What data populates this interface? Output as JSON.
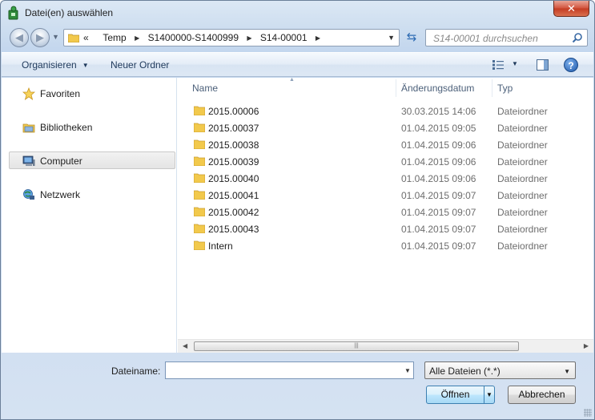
{
  "window": {
    "title": "Datei(en) auswählen",
    "close_label": "✕"
  },
  "address": {
    "crumbs_prefix": "«",
    "crumbs": [
      "Temp",
      "S1400000-S1400999",
      "S14-00001"
    ],
    "separator": "▶"
  },
  "search": {
    "placeholder": "S14-00001 durchsuchen"
  },
  "toolbar": {
    "organize_label": "Organisieren",
    "new_folder_label": "Neuer Ordner",
    "help_label": "?"
  },
  "nav": {
    "favorites": "Favoriten",
    "libraries": "Bibliotheken",
    "computer": "Computer",
    "network": "Netzwerk"
  },
  "columns": {
    "name": "Name",
    "date": "Änderungsdatum",
    "type": "Typ"
  },
  "files": [
    {
      "name": "2015.00006",
      "date": "30.03.2015 14:06",
      "type": "Dateiordner"
    },
    {
      "name": "2015.00037",
      "date": "01.04.2015 09:05",
      "type": "Dateiordner"
    },
    {
      "name": "2015.00038",
      "date": "01.04.2015 09:06",
      "type": "Dateiordner"
    },
    {
      "name": "2015.00039",
      "date": "01.04.2015 09:06",
      "type": "Dateiordner"
    },
    {
      "name": "2015.00040",
      "date": "01.04.2015 09:06",
      "type": "Dateiordner"
    },
    {
      "name": "2015.00041",
      "date": "01.04.2015 09:07",
      "type": "Dateiordner"
    },
    {
      "name": "2015.00042",
      "date": "01.04.2015 09:07",
      "type": "Dateiordner"
    },
    {
      "name": "2015.00043",
      "date": "01.04.2015 09:07",
      "type": "Dateiordner"
    },
    {
      "name": "Intern",
      "date": "01.04.2015 09:07",
      "type": "Dateiordner"
    }
  ],
  "bottom": {
    "filename_label": "Dateiname:",
    "filename_value": "",
    "filter_value": "Alle Dateien (*.*)",
    "open_label": "Öffnen",
    "cancel_label": "Abbrechen"
  },
  "colors": {
    "folder": "#f2c94c",
    "accent": "#3c7fb1"
  }
}
